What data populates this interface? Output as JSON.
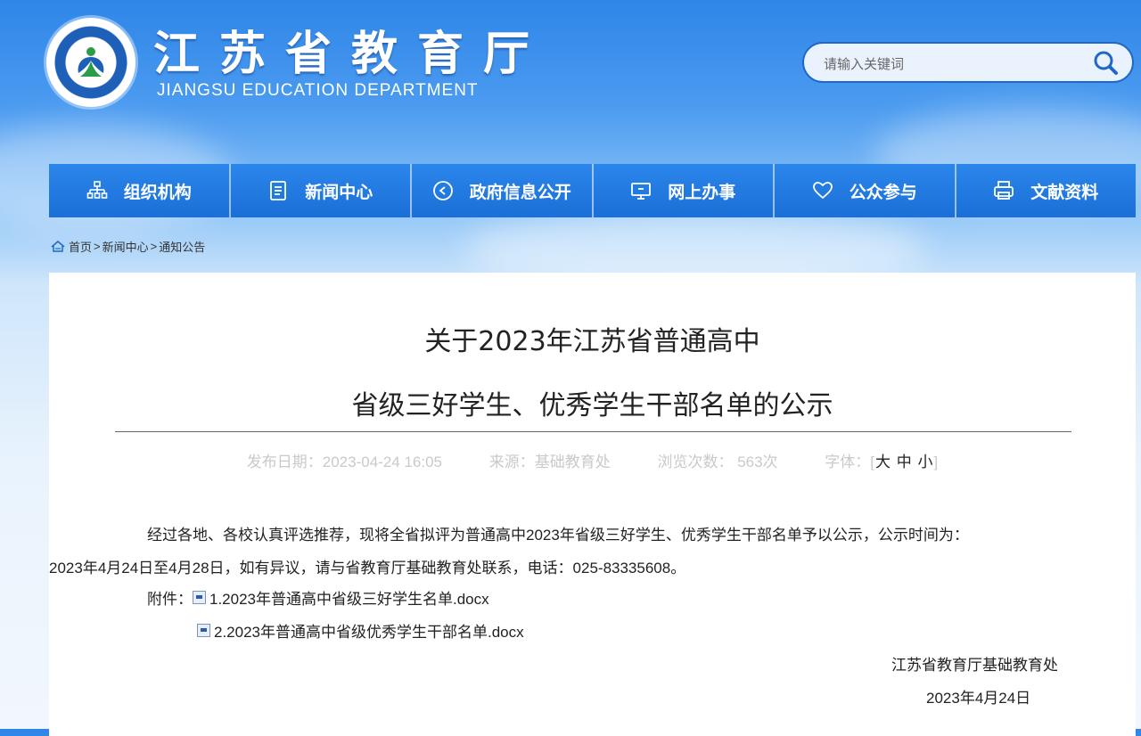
{
  "header": {
    "title": "江苏省教育厅",
    "subtitle": "JIANGSU EDUCATION DEPARTMENT",
    "search_placeholder": "请输入关键词"
  },
  "nav": [
    {
      "label": "组织机构",
      "icon": "org-chart-icon"
    },
    {
      "label": "新闻中心",
      "icon": "document-icon"
    },
    {
      "label": "政府信息公开",
      "icon": "play-circle-icon"
    },
    {
      "label": "网上办事",
      "icon": "monitor-icon"
    },
    {
      "label": "公众参与",
      "icon": "heart-icon"
    },
    {
      "label": "文献资料",
      "icon": "printer-icon"
    }
  ],
  "breadcrumb": {
    "home": "首页",
    "sep": ">",
    "level1": "新闻中心",
    "level2": "通知公告"
  },
  "article": {
    "title_line1": "关于2023年江苏省普通高中",
    "title_line2": "省级三好学生、优秀学生干部名单的公示",
    "meta": {
      "date": "发布日期：2023-04-24 16:05",
      "source": "来源：基础教育处",
      "views": "浏览次数： 563次",
      "font_label": "字体：",
      "font_open": "[",
      "font_large": "大",
      "font_medium": "中",
      "font_small": "小",
      "font_close": "]"
    },
    "para1": "经过各地、各校认真评选推荐，现将全省拟评为普通高中2023年省级三好学生、优秀学生干部名单予以公示，公示时间为：",
    "para2": "2023年4月24日至4月28日，如有异议，请与省教育厅基础教育处联系，电话：025-83335608。",
    "attach_label": "附件：",
    "attachments": [
      "1.2023年普通高中省级三好学生名单.docx",
      "2.2023年普通高中省级优秀学生干部名单.docx"
    ],
    "signature_org": "江苏省教育厅基础教育处",
    "signature_date": "2023年4月24日"
  },
  "colors": {
    "nav_bg": "#1f74dc",
    "header_blue": "#2f86e8",
    "accent": "#1f68c8"
  }
}
